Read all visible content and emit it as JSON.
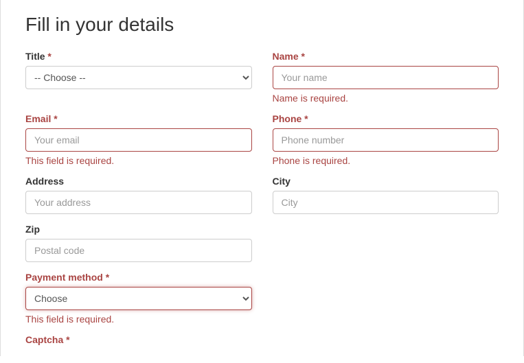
{
  "title": "Fill in your details",
  "required_marker": "*",
  "fields": {
    "title": {
      "label": "Title",
      "placeholder_option": "-- Choose --"
    },
    "name": {
      "label": "Name",
      "placeholder": "Your name",
      "error": "Name is required."
    },
    "email": {
      "label": "Email",
      "placeholder": "Your email",
      "error": "This field is required."
    },
    "phone": {
      "label": "Phone",
      "placeholder": "Phone number",
      "error": "Phone is required."
    },
    "address": {
      "label": "Address",
      "placeholder": "Your address"
    },
    "city": {
      "label": "City",
      "placeholder": "City"
    },
    "zip": {
      "label": "Zip",
      "placeholder": "Postal code"
    },
    "payment": {
      "label": "Payment method",
      "placeholder_option": "Choose",
      "error": "This field is required."
    },
    "captcha": {
      "label": "Captcha"
    }
  }
}
